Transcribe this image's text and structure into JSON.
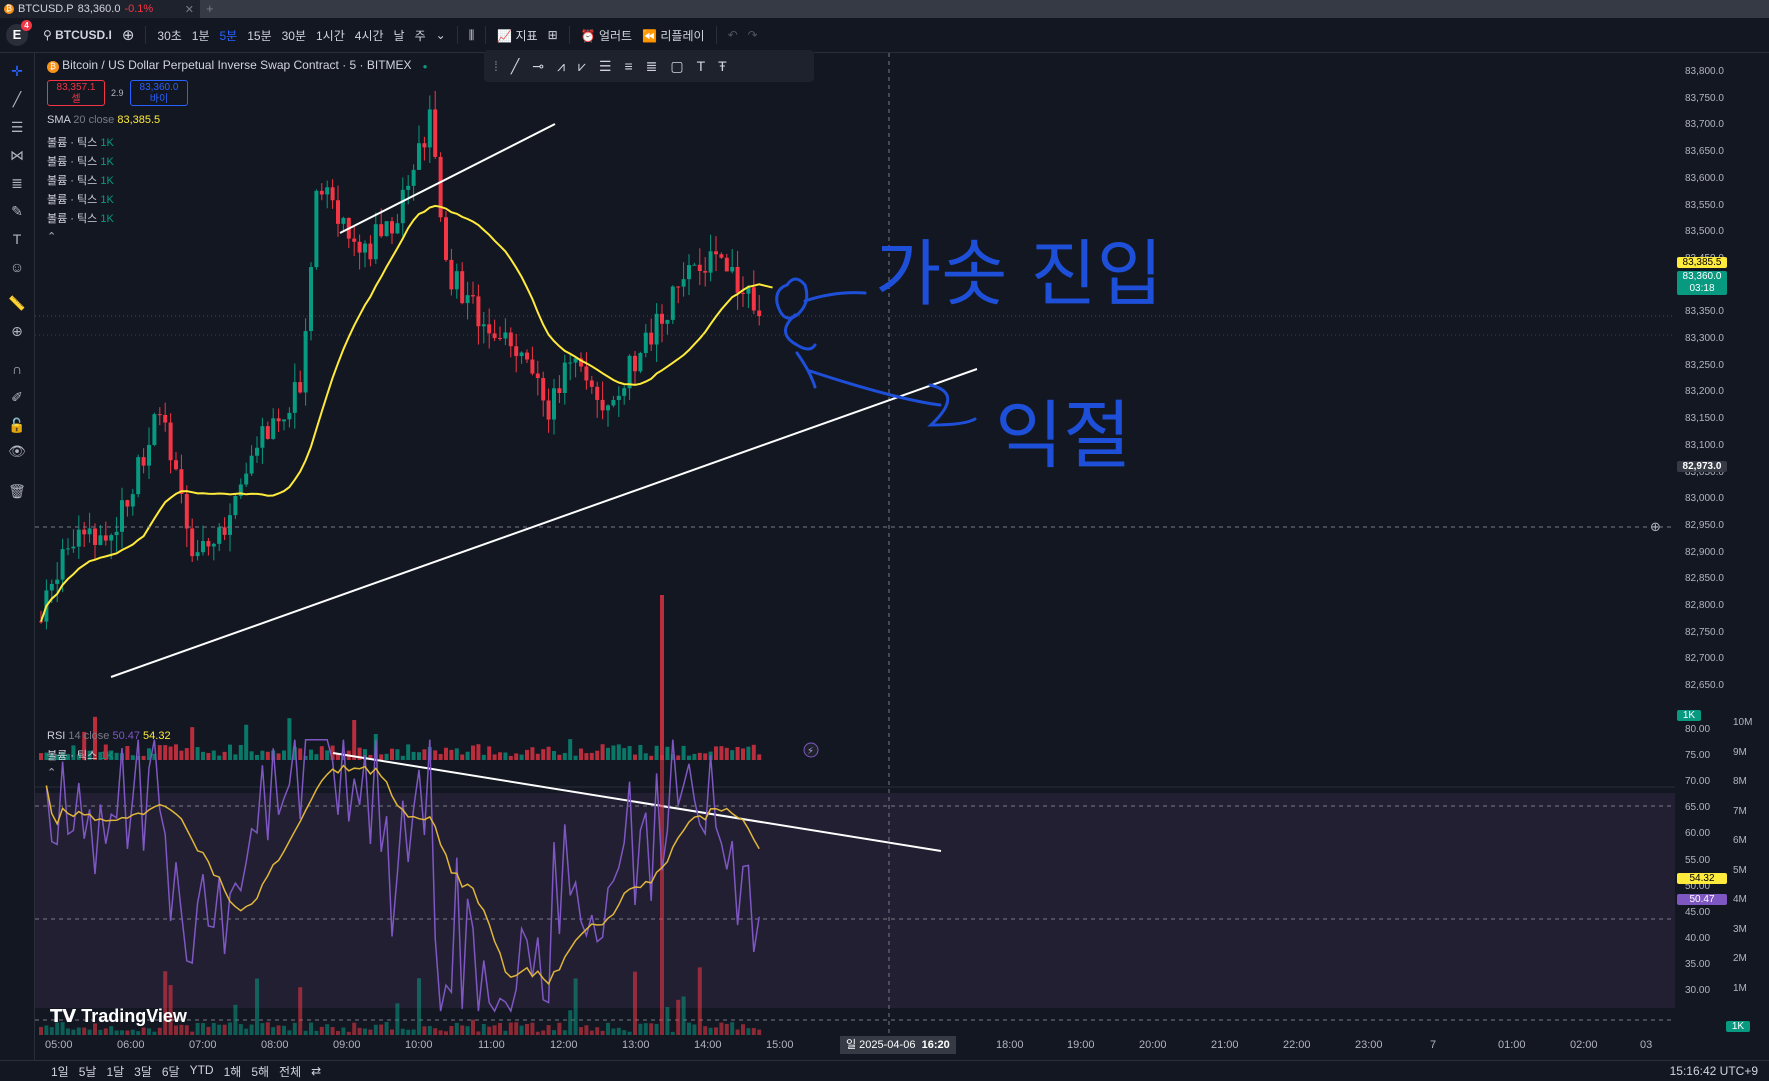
{
  "browser_tab": {
    "title": "BTCUSD.P",
    "price": "83,360.0",
    "change": "-0.1%"
  },
  "toolbar": {
    "avatar_letter": "E",
    "avatar_badge": "4",
    "symbol": "BTCUSD.I",
    "intervals": [
      "30초",
      "1분",
      "5분",
      "15분",
      "30분",
      "1시간",
      "4시간",
      "날",
      "주"
    ],
    "active_interval": "5분",
    "indicators_label": "지표",
    "alert_label": "얼러트",
    "replay_label": "리플레이"
  },
  "legend": {
    "title": "Bitcoin / US Dollar Perpetual Inverse Swap Contract · 5 · BITMEX",
    "bid_price": "83,357.1",
    "bid_label": "셀",
    "spread": "2.9",
    "ask_price": "83,360.0",
    "ask_label": "바이",
    "sma_name": "SMA",
    "sma_params": "20 close",
    "sma_value": "83,385.5",
    "volume_rows": [
      {
        "name": "볼륨 · 틱스",
        "value": "1K"
      },
      {
        "name": "볼륨 · 틱스",
        "value": "1K"
      },
      {
        "name": "볼륨 · 틱스",
        "value": "1K"
      },
      {
        "name": "볼륨 · 틱스",
        "value": "1K"
      },
      {
        "name": "볼륨 · 틱스",
        "value": "1K"
      }
    ]
  },
  "rsi_legend": {
    "name": "RSI",
    "params": "14 close",
    "value1": "50.47",
    "value2": "54.32",
    "volume_name": "볼륨 · 틱스",
    "volume_value": "1K"
  },
  "price_axis": {
    "labels": [
      "83,800.0",
      "83,750.0",
      "83,700.0",
      "83,650.0",
      "83,600.0",
      "83,550.0",
      "83,500.0",
      "83,450.0",
      "83,400.0",
      "83,350.0",
      "83,300.0",
      "83,250.0",
      "83,200.0",
      "83,150.0",
      "83,100.0",
      "83,050.0",
      "83,000.0",
      "82,950.0",
      "82,900.0",
      "82,850.0",
      "82,800.0",
      "82,750.0",
      "82,700.0",
      "82,650.0"
    ],
    "sma_tag": "83,385.5",
    "last_price_tag": "83,360.0",
    "countdown": "03:18",
    "crosshair_tag": "82,973.0",
    "volume_tag": "1K"
  },
  "rsi_axis": {
    "labels": [
      "80.00",
      "75.00",
      "70.00",
      "65.00",
      "60.00",
      "55.00",
      "50.00",
      "45.00",
      "40.00",
      "35.00",
      "30.00"
    ],
    "tag_yellow": "54.32",
    "tag_purple": "50.47",
    "volume_labels": [
      "10M",
      "9M",
      "8M",
      "7M",
      "6M",
      "5M",
      "4M",
      "3M",
      "2M",
      "1M"
    ],
    "volume_tag": "1K"
  },
  "time_axis": {
    "labels": [
      "05:00",
      "06:00",
      "07:00",
      "08:00",
      "09:00",
      "10:00",
      "11:00",
      "12:00",
      "13:00",
      "14:00",
      "15:00",
      "18:00",
      "19:00",
      "20:00",
      "21:00",
      "22:00",
      "23:00",
      "7",
      "01:00",
      "02:00",
      "03"
    ],
    "crosshair_date": "일 2025-04-06",
    "crosshair_time": "16:20"
  },
  "bottom_bar": {
    "ranges": [
      "1일",
      "5날",
      "1달",
      "3달",
      "6달",
      "YTD",
      "1해",
      "5해",
      "전체"
    ],
    "clock": "15:16:42 UTC+9"
  },
  "annotations": {
    "text1": "가솟 진입",
    "text2": "익절"
  },
  "watermark": "TradingView",
  "colors": {
    "up": "#089981",
    "down": "#f23645",
    "sma": "#ffeb3b",
    "rsi": "#7e57c2",
    "accent": "#2962ff",
    "annotation": "#1e4fd8"
  }
}
